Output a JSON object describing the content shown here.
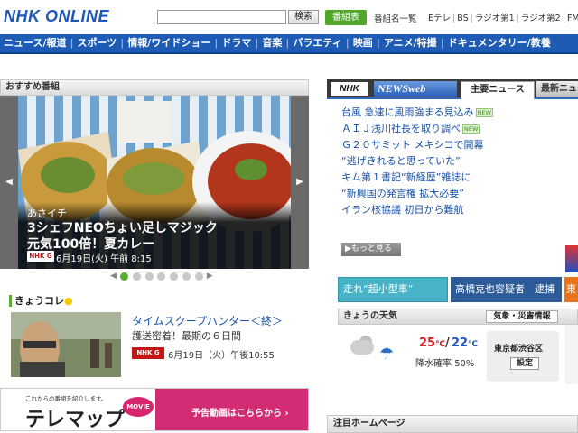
{
  "header": {
    "logo": "NHK ONLINE",
    "search_button": "検索",
    "program_table_button": "番組表",
    "program_list_link": "番組名一覧",
    "channels": [
      "Eテレ",
      "BS",
      "ラジオ第1",
      "ラジオ第2",
      "FM"
    ]
  },
  "nav": {
    "items": [
      "ニュース/報道",
      "スポーツ",
      "情報/ワイドショー",
      "ドラマ",
      "音楽",
      "バラエティ",
      "映画",
      "アニメ/特撮",
      "ドキュメンタリー/教養"
    ]
  },
  "recommended": {
    "heading": "おすすめ番組",
    "slide": {
      "image_label": "あさイチ",
      "program": "あさイチ",
      "title_line1": "3シェフNEOちょい足しマジック",
      "title_line2": "元気100倍！夏カレー",
      "channel_badge": "NHK G",
      "air_time": "6月19日(火) 午前 8:15"
    },
    "page_count": 7,
    "active_page": 1
  },
  "kyoukore": {
    "heading": "きょうコレ",
    "title": "タイムスクープハンター＜終＞",
    "subtitle": "護送密着！最期の６日間",
    "channel_badge": "NHK G",
    "air_time": "6月19日（火）午後10:55"
  },
  "telemap": {
    "tagline": "これからの番組を紹介します。",
    "title": "テレマップ",
    "movie_badge": "MOVIE",
    "link": "予告動画はこちらから ›"
  },
  "news": {
    "logo": "NHK",
    "web_label": "NEWSweb",
    "tab_main": "主要ニュース",
    "tab_latest": "最新ニュース",
    "new_label": "NEW",
    "items": [
      {
        "text": "台風 急速に風雨強まる見込み",
        "new": true
      },
      {
        "text": "ＡＩＪ浅川社長を取り調べ",
        "new": true
      },
      {
        "text": "Ｇ２０サミット メキシコで開幕",
        "new": false
      },
      {
        "text": "“逃げきれると思っていた”",
        "new": false
      },
      {
        "text": "キム第１書記“新経歴”雑誌に",
        "new": false
      },
      {
        "text": "“新興国の発言権 拡大必要”",
        "new": false
      },
      {
        "text": "イラン核協議 初日から難航",
        "new": false
      }
    ],
    "more_button": "▶もっと見る"
  },
  "tiles": {
    "tile1": "走れ“超小型車”",
    "tile2": "高橋克也容疑者　逮捕",
    "tile3": "東"
  },
  "weather": {
    "heading": "きょうの天気",
    "disaster_button": "気象・災害情報",
    "high": "25",
    "low": "22",
    "unit": "℃",
    "sep": "/",
    "rain_label": "降水確率",
    "rain_value": "50%",
    "location": "東京都渋谷区",
    "settings_button": "設定"
  },
  "attention": {
    "heading": "注目ホームページ"
  },
  "colors": {
    "nav_blue": "#1d5bb4",
    "green": "#5aad2d",
    "link_blue": "#1751a8",
    "pink": "#d12c74"
  }
}
